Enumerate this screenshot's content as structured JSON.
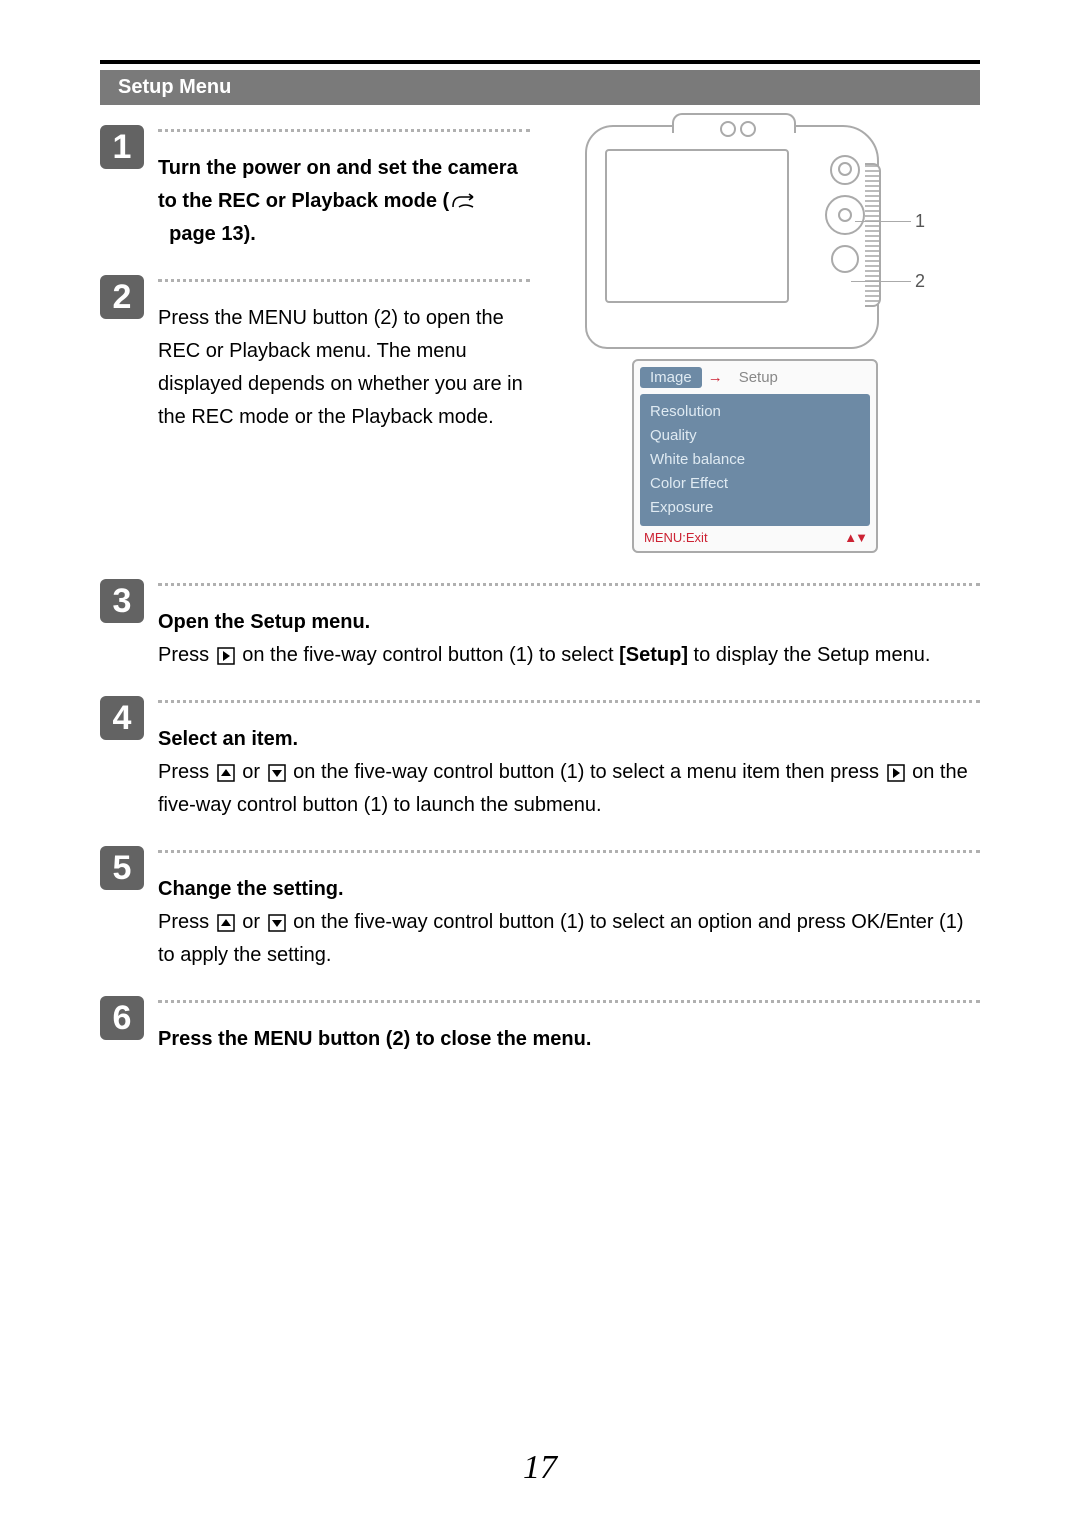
{
  "section_title": "Setup Menu",
  "page_number": "17",
  "steps": [
    {
      "num": "1",
      "title_part1": "Turn the power on and set the camera to the REC or Playback mode (",
      "title_part2": "page 13).",
      "body": ""
    },
    {
      "num": "2",
      "title": "",
      "body": "Press the MENU button (2) to open the REC or Playback menu. The menu displayed depends on whether you are in the REC mode or the Playback mode."
    },
    {
      "num": "3",
      "title": "Open the Setup menu.",
      "body_part1": "Press ",
      "body_part2": " on the five-way control button (1) to select ",
      "body_bold": "[Setup]",
      "body_part3": " to display the Setup menu."
    },
    {
      "num": "4",
      "title": "Select an item.",
      "body_part1": "Press ",
      "body_part2": " or ",
      "body_part3": " on the five-way control button (1) to select a menu item then press ",
      "body_part4": " on the five-way control button (1) to launch the submenu."
    },
    {
      "num": "5",
      "title": "Change the setting.",
      "body_part1": "Press ",
      "body_part2": " or ",
      "body_part3": " on the five-way control button (1) to select an option and press OK/Enter (1) to apply the setting."
    },
    {
      "num": "6",
      "title": "Press the MENU button (2) to close the menu.",
      "body": ""
    }
  ],
  "diagram": {
    "callout1": "1",
    "callout2": "2",
    "tab_active": "Image",
    "tab_inactive": "Setup",
    "menu_items": [
      "Resolution",
      "Quality",
      "White balance",
      "Color Effect",
      "Exposure"
    ],
    "footer_exit": "MENU:Exit",
    "footer_arrows": "▲▼"
  }
}
